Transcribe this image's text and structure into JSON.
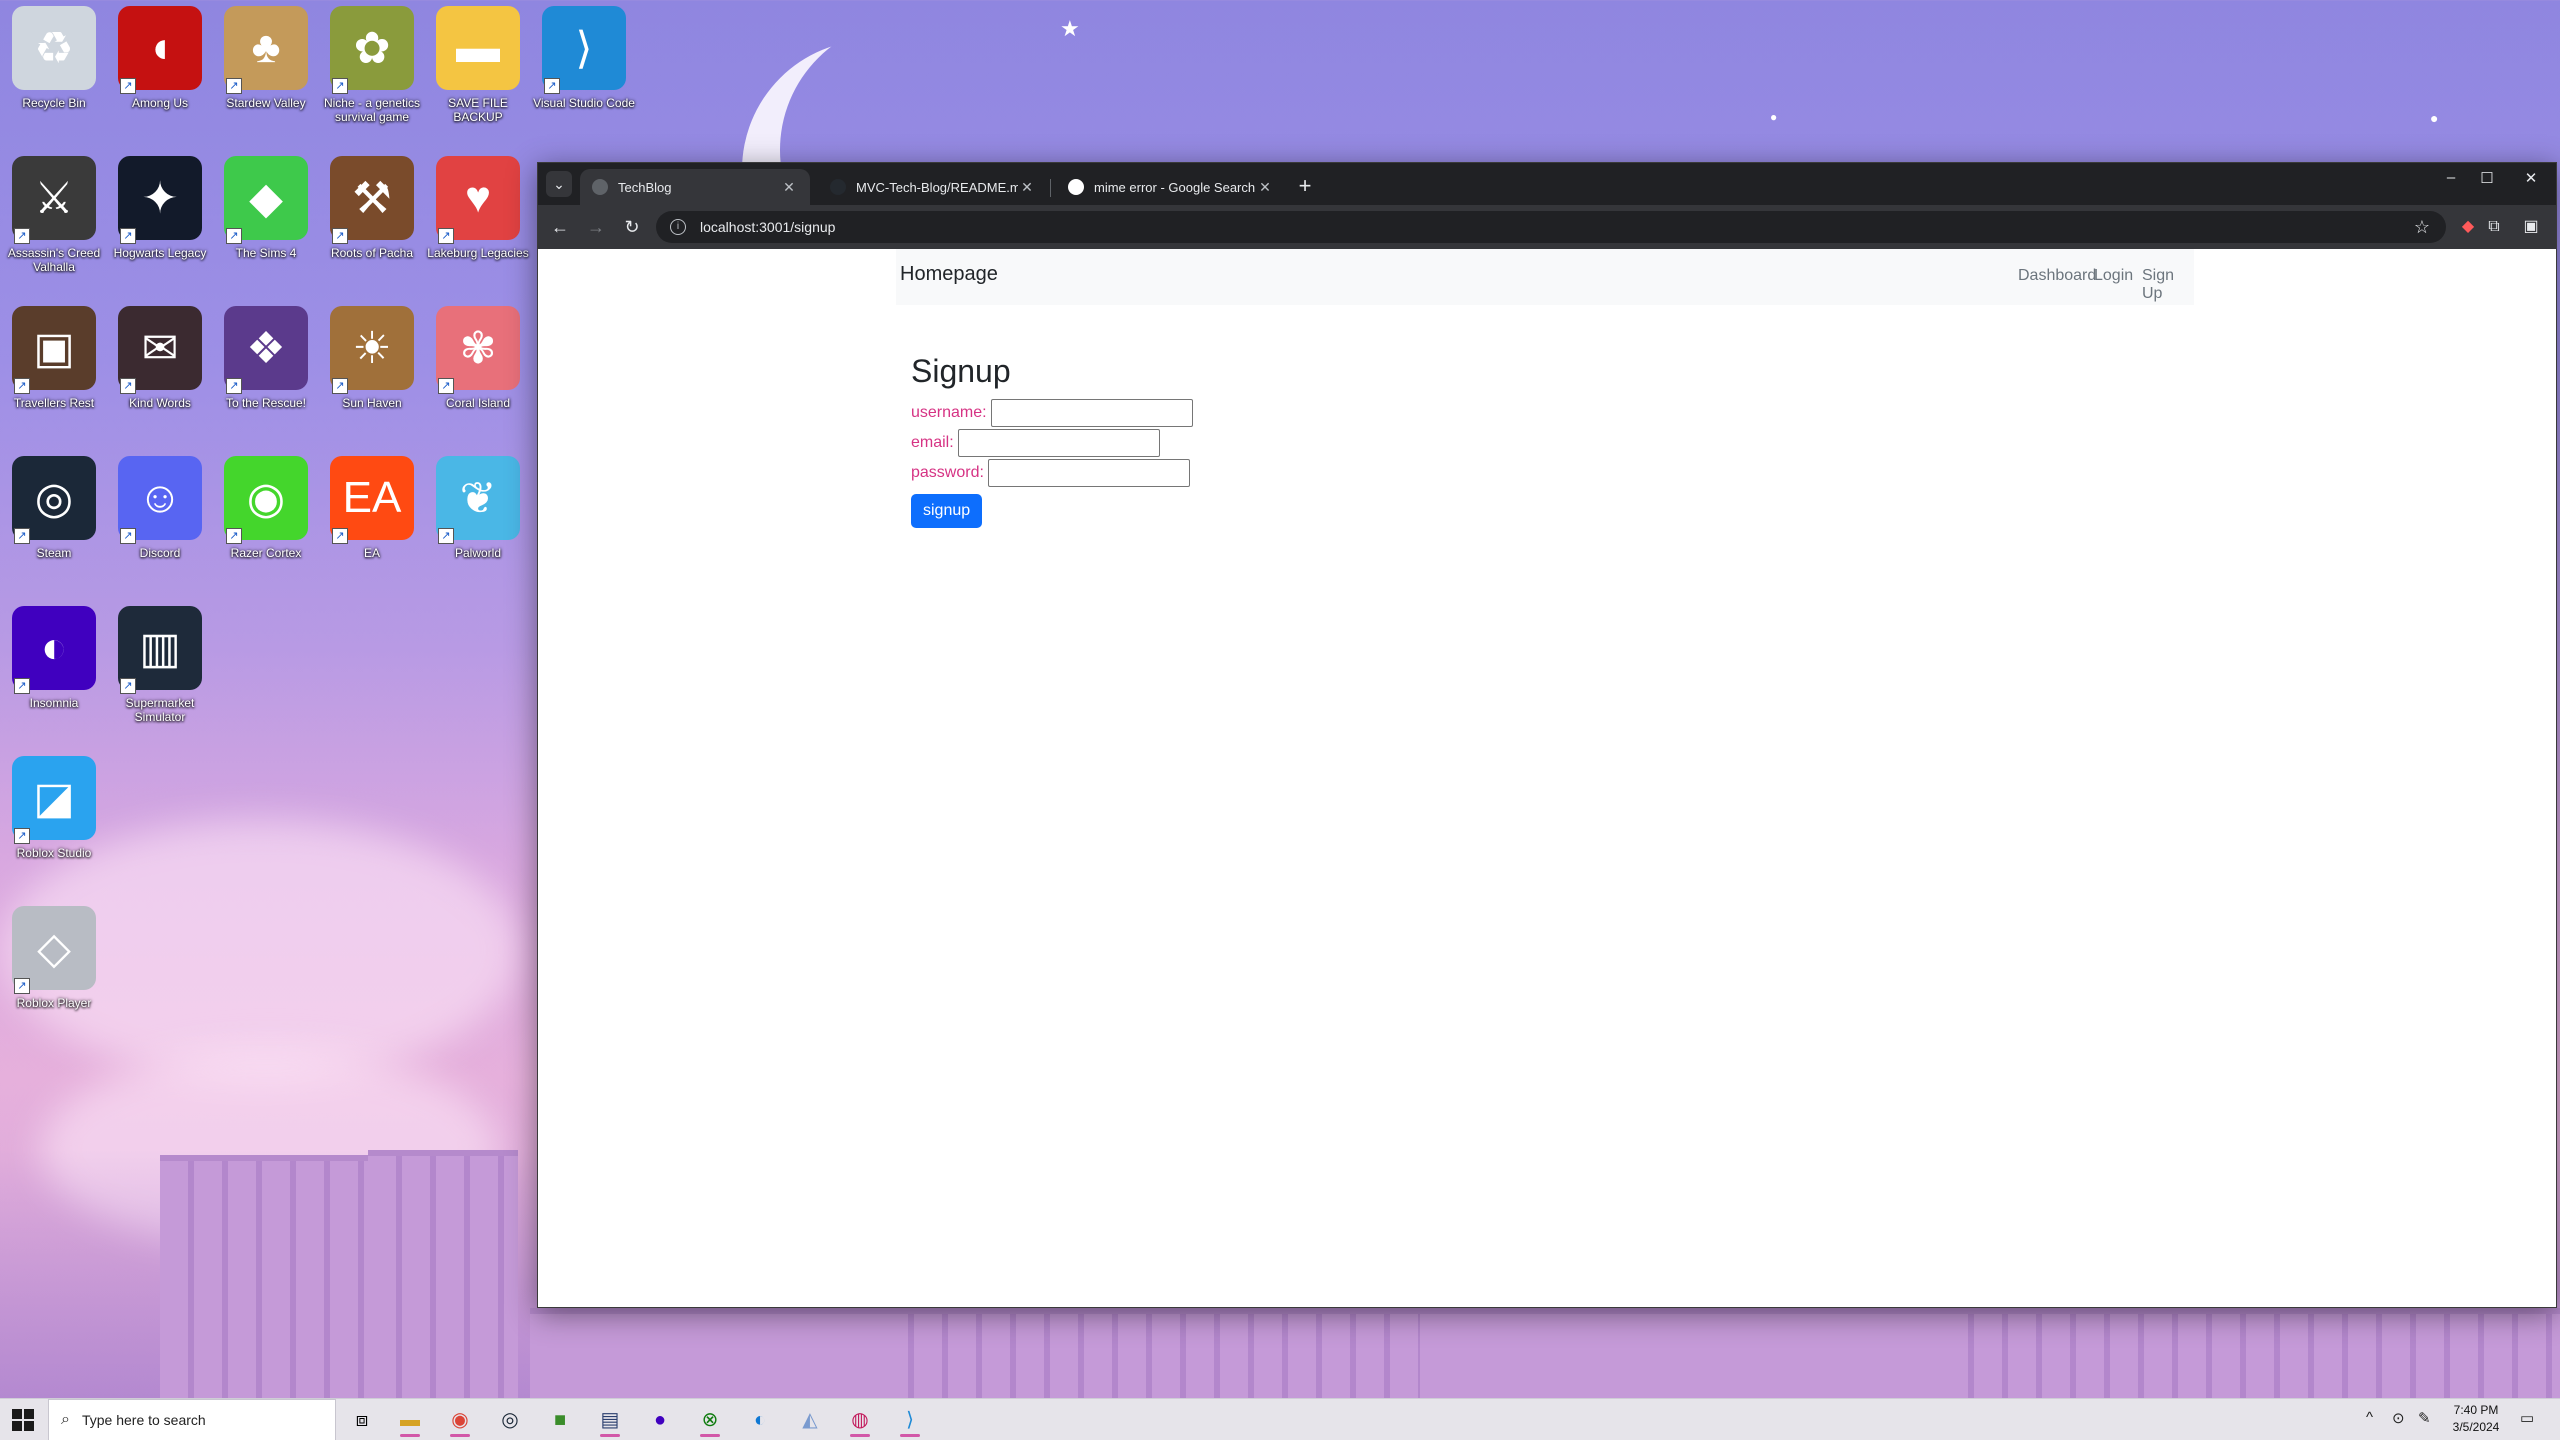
{
  "desktop": {
    "icons": [
      {
        "label": "Recycle Bin",
        "icon": "recycle-bin-icon",
        "color": "#cfd6de"
      },
      {
        "label": "Among Us",
        "icon": "among-us-icon",
        "color": "#c51111"
      },
      {
        "label": "Stardew Valley",
        "icon": "stardew-valley-icon",
        "color": "#c49a5a"
      },
      {
        "label": "Niche - a genetics survival game",
        "icon": "niche-icon",
        "color": "#8a9b3c"
      },
      {
        "label": "SAVE FILE BACKUP",
        "icon": "folder-icon",
        "color": "#f4c542"
      },
      {
        "label": "Visual Studio Code",
        "icon": "vscode-icon",
        "color": "#1f8ad6"
      },
      {
        "label": "Assassin's Creed Valhalla",
        "icon": "assassins-creed-icon",
        "color": "#3a3a3a"
      },
      {
        "label": "Hogwarts Legacy",
        "icon": "hogwarts-legacy-icon",
        "color": "#121a2a"
      },
      {
        "label": "The Sims 4",
        "icon": "sims-4-icon",
        "color": "#3ec94b"
      },
      {
        "label": "Roots of Pacha",
        "icon": "roots-of-pacha-icon",
        "color": "#7a4b2b"
      },
      {
        "label": "Lakeburg Legacies",
        "icon": "lakeburg-legacies-icon",
        "color": "#e14242"
      },
      {
        "label": "Travellers Rest",
        "icon": "travellers-rest-icon",
        "color": "#5a3d2b"
      },
      {
        "label": "Kind Words",
        "icon": "kind-words-icon",
        "color": "#3b2a30"
      },
      {
        "label": "To the Rescue!",
        "icon": "to-the-rescue-icon",
        "color": "#5b3a8c"
      },
      {
        "label": "Sun Haven",
        "icon": "sun-haven-icon",
        "color": "#a0703a"
      },
      {
        "label": "Coral Island",
        "icon": "coral-island-icon",
        "color": "#e8707a"
      },
      {
        "label": "Steam",
        "icon": "steam-icon",
        "color": "#1b2838"
      },
      {
        "label": "Discord",
        "icon": "discord-icon",
        "color": "#5865f2"
      },
      {
        "label": "Razer Cortex",
        "icon": "razer-cortex-icon",
        "color": "#44d62c"
      },
      {
        "label": "EA",
        "icon": "ea-icon",
        "color": "#ff4a12"
      },
      {
        "label": "Palworld",
        "icon": "palworld-icon",
        "color": "#4ab7e6"
      },
      {
        "label": "Insomnia",
        "icon": "insomnia-icon",
        "color": "#4000bf"
      },
      {
        "label": "Supermarket Simulator",
        "icon": "supermarket-simulator-icon",
        "color": "#1e2a3a"
      },
      {
        "label": "Roblox Studio",
        "icon": "roblox-studio-icon",
        "color": "#2aa3ef"
      },
      {
        "label": "Roblox Player",
        "icon": "roblox-player-icon",
        "color": "#b8bcc4"
      }
    ]
  },
  "browser": {
    "tabs": [
      {
        "title": "TechBlog",
        "close": "✕"
      },
      {
        "title": "MVC-Tech-Blog/README.md at",
        "close": "✕"
      },
      {
        "title": "mime error - Google Search",
        "close": "✕"
      }
    ],
    "new_tab": "+",
    "url": "localhost:3001/signup",
    "window_controls": {
      "minimize": "–",
      "maximize": "☐",
      "close": "✕"
    }
  },
  "site": {
    "brand": "Homepage",
    "nav": [
      "Dashboard",
      "Login",
      "Sign Up"
    ],
    "heading": "Signup",
    "fields": [
      {
        "label": "username:",
        "value": ""
      },
      {
        "label": "email:",
        "value": ""
      },
      {
        "label": "password:",
        "value": ""
      }
    ],
    "submit_label": "signup",
    "accent_color": "#0d6efd",
    "label_color": "#d63384"
  },
  "taskbar": {
    "search_placeholder": "Type here to search",
    "time": "7:40 PM",
    "date": "3/5/2024"
  }
}
